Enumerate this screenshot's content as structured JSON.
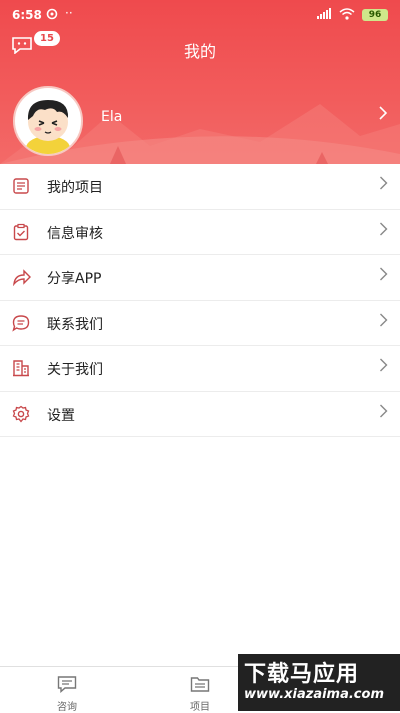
{
  "status_bar": {
    "time": "6:58",
    "battery": "96"
  },
  "header": {
    "title": "我的",
    "message_badge": "15"
  },
  "profile": {
    "name": "Ela"
  },
  "menu": {
    "items": [
      {
        "label": "我的项目",
        "icon": "document-icon"
      },
      {
        "label": "信息审核",
        "icon": "clipboard-check-icon"
      },
      {
        "label": "分享APP",
        "icon": "share-icon"
      },
      {
        "label": "联系我们",
        "icon": "chat-icon"
      },
      {
        "label": "关于我们",
        "icon": "building-icon"
      },
      {
        "label": "设置",
        "icon": "gear-icon"
      }
    ]
  },
  "tabbar": {
    "tabs": [
      {
        "label": "咨询",
        "icon": "message-icon"
      },
      {
        "label": "项目",
        "icon": "folder-list-icon"
      }
    ]
  },
  "watermark": {
    "title": "下载马应用",
    "url": "www.xiazaima.com"
  },
  "colors": {
    "accent": "#ef4a4d"
  }
}
